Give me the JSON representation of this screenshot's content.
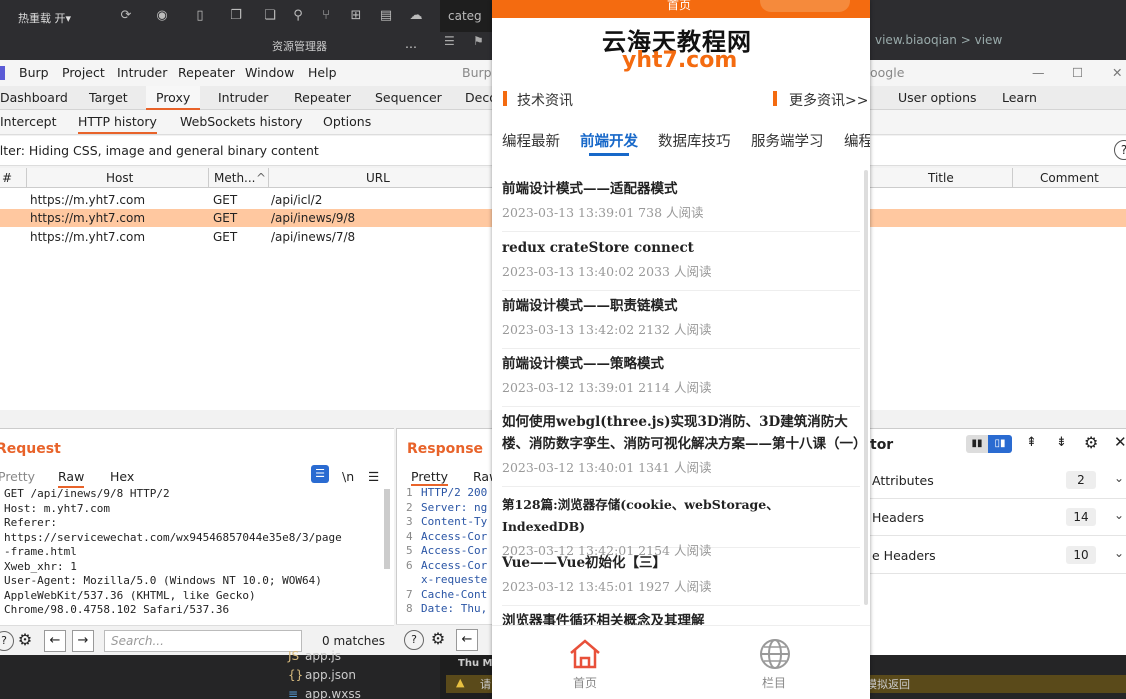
{
  "ide_top": {
    "hot_reload": "热重载 开▾",
    "tab": "categ",
    "explorer": "资源管理器",
    "more": "...",
    "path_parts": [
      "view.biaoqian",
      ">",
      "view"
    ]
  },
  "burp": {
    "menu": [
      "Burp",
      "Project",
      "Intruder",
      "Repeater",
      "Window",
      "Help"
    ],
    "title_right": "Burp",
    "title_right2": "oogle",
    "tabs1": [
      "Dashboard",
      "Target",
      "Proxy",
      "Intruder",
      "Repeater",
      "Sequencer",
      "Deco"
    ],
    "tabs1_right": [
      "User options",
      "Learn"
    ],
    "tabs2": [
      "Intercept",
      "HTTP history",
      "WebSockets history",
      "Options"
    ],
    "filter": "Filter: Hiding CSS, image and general binary content",
    "columns": {
      "num": "#",
      "host": "Host",
      "method": "Meth...",
      "url": "URL",
      "title": "Title",
      "comment": "Comment"
    },
    "rows": [
      {
        "host": "https://m.yht7.com",
        "method": "GET",
        "url": "/api/icl/2"
      },
      {
        "host": "https://m.yht7.com",
        "method": "GET",
        "url": "/api/inews/9/8"
      },
      {
        "host": "https://m.yht7.com",
        "method": "GET",
        "url": "/api/inews/7/8"
      }
    ],
    "request": {
      "title": "Request",
      "tabs": [
        "Pretty",
        "Raw",
        "Hex"
      ],
      "lines": [
        "GET /api/inews/9/8 HTTP/2",
        "Host: m.yht7.com",
        "Referer:",
        "https://servicewechat.com/wx94546857044e35e8/3/page",
        "-frame.html",
        "Xweb_xhr: 1",
        "User-Agent: Mozilla/5.0 (Windows NT 10.0; WOW64)",
        "AppleWebKit/537.36 (KHTML, like Gecko)",
        "Chrome/98.0.4758.102 Safari/537.36"
      ],
      "search_placeholder": "Search...",
      "matches": "0 matches",
      "newline_icon": "\\n"
    },
    "response": {
      "title": "Response",
      "tabs": [
        "Pretty",
        "Raw"
      ],
      "lines": [
        "HTTP/2 200",
        "Server: ng",
        "Content-Ty",
        "Access-Cor",
        "Access-Cor",
        "Access-Cor",
        "x-requeste",
        "Cache-Cont",
        "Date: Thu,"
      ]
    },
    "inspector": {
      "title": "tor",
      "rows": [
        {
          "label": "Attributes",
          "count": "2"
        },
        {
          "label": "Headers",
          "count": "14"
        },
        {
          "label": "e Headers",
          "count": "10"
        }
      ]
    }
  },
  "ide_bottom": {
    "files": [
      "app.js",
      "app.json",
      "app.wxss"
    ],
    "log1": "Thu Ma",
    "log2": "请",
    "log3": "模拟返回"
  },
  "phone": {
    "top_title": "首页",
    "logo_cn": "云海天教程网",
    "logo_en": "yht7.com",
    "section": "技术资讯",
    "more": "更多资讯>>",
    "categories": [
      "编程最新",
      "前端开发",
      "数据库技巧",
      "服务端学习",
      "编程"
    ],
    "news": [
      {
        "title": "前端设计模式——适配器模式",
        "meta": "2023-03-13 13:39:01 738 人阅读"
      },
      {
        "title": "redux crateStore connect",
        "meta": "2023-03-13 13:40:02 2033 人阅读"
      },
      {
        "title": "前端设计模式——职责链模式",
        "meta": "2023-03-13 13:42:02 2132 人阅读"
      },
      {
        "title": "前端设计模式——策略模式",
        "meta": "2023-03-12 13:39:01 2114 人阅读"
      },
      {
        "title": "如何使用webgl(three.js)实现3D消防、3D建筑消防大楼、消防数字孪生、消防可视化解决方案——第十八课（一）",
        "meta": "2023-03-12 13:40:01 1341 人阅读"
      },
      {
        "title": "第128篇:浏览器存储(cookie、webStorage、 IndexedDB)",
        "meta": "2023-03-12 13:42:01 2154 人阅读"
      },
      {
        "title": "Vue——Vue初始化【三】",
        "meta": "2023-03-12 13:45:01 1927 人阅读"
      },
      {
        "title": "浏览器事件循环相关概念及其理解",
        "meta": ""
      }
    ],
    "tabbar": [
      {
        "label": "首页"
      },
      {
        "label": "栏目"
      }
    ],
    "colors": {
      "accent": "#f46b10",
      "link": "#1768c9"
    }
  }
}
